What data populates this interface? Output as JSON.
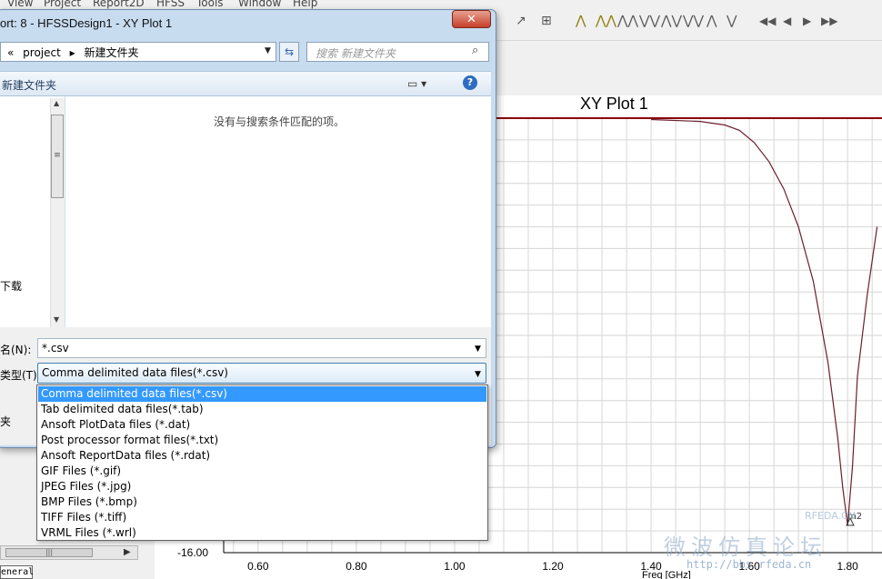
{
  "menubar": {
    "items": [
      "View",
      "Project",
      "Report2D",
      "HFSS",
      "Tools",
      "Window",
      "Help"
    ]
  },
  "toolbar": {
    "glyphs": [
      "◀◀",
      "◀",
      "▶",
      "▶▶"
    ]
  },
  "dialog": {
    "title": "ort: 8 - HFSSDesign1 - XY Plot 1",
    "close_label": "✕",
    "address": {
      "parts": [
        "«",
        "project",
        "▸",
        "新建文件夹"
      ]
    },
    "search": {
      "placeholder": "搜索 新建文件夹"
    },
    "cmdbar": {
      "folder_label": "新建文件夹"
    },
    "navpane": {
      "item_download": "下载"
    },
    "filelist": {
      "empty_message": "没有与搜索条件匹配的项。"
    },
    "filename": {
      "label": "名(N):",
      "value": "*.csv"
    },
    "filetype": {
      "label": "类型(T):",
      "value": "Comma delimited data files(*.csv)",
      "options": [
        "Comma delimited data files(*.csv)",
        "Tab delimited data files(*.tab)",
        "Ansoft PlotData files (*.dat)",
        "Post processor format files(*.txt)",
        "Ansoft ReportData files (*.rdat)",
        "GIF Files (*.gif)",
        "JPEG Files (*.jpg)",
        "BMP Files (*.bmp)",
        "TIFF Files (*.tiff)",
        "VRML Files (*.wrl)"
      ],
      "selected_index": 0
    },
    "hide_folders": "夹"
  },
  "left_panel": {
    "tab_label": "eneral"
  },
  "plot": {
    "title": "XY Plot 1",
    "marker": "m2",
    "accent_color": "#8b0000"
  },
  "chart_data": {
    "type": "line",
    "title": "XY Plot 1",
    "xlabel": "Freq [GHz]",
    "ylabel": "",
    "xlim": [
      0.53,
      1.87
    ],
    "ylim": [
      -16.0,
      0.0
    ],
    "x_ticks": [
      "0.60",
      "0.80",
      "1.00",
      "1.20",
      "1.40",
      "1.60",
      "1.80"
    ],
    "y_ticks": [
      "-16.00"
    ],
    "grid": true,
    "series": [
      {
        "x": [
          1.4,
          1.5,
          1.55,
          1.58,
          1.61,
          1.64,
          1.67,
          1.7,
          1.73,
          1.76,
          1.78,
          1.79,
          1.8,
          1.81,
          1.82,
          1.84,
          1.86
        ],
        "y": [
          -0.05,
          -0.12,
          -0.25,
          -0.45,
          -0.9,
          -1.6,
          -2.6,
          -4.0,
          -6.0,
          -9.0,
          -11.8,
          -13.6,
          -15.0,
          -12.8,
          -9.5,
          -6.5,
          -4.0
        ],
        "color": "#6b1e2e"
      }
    ]
  },
  "watermark": {
    "cn": "微波仿真论坛",
    "url": "http://bbs.rfeda.cn",
    "brand": "RFEDA.CN"
  }
}
